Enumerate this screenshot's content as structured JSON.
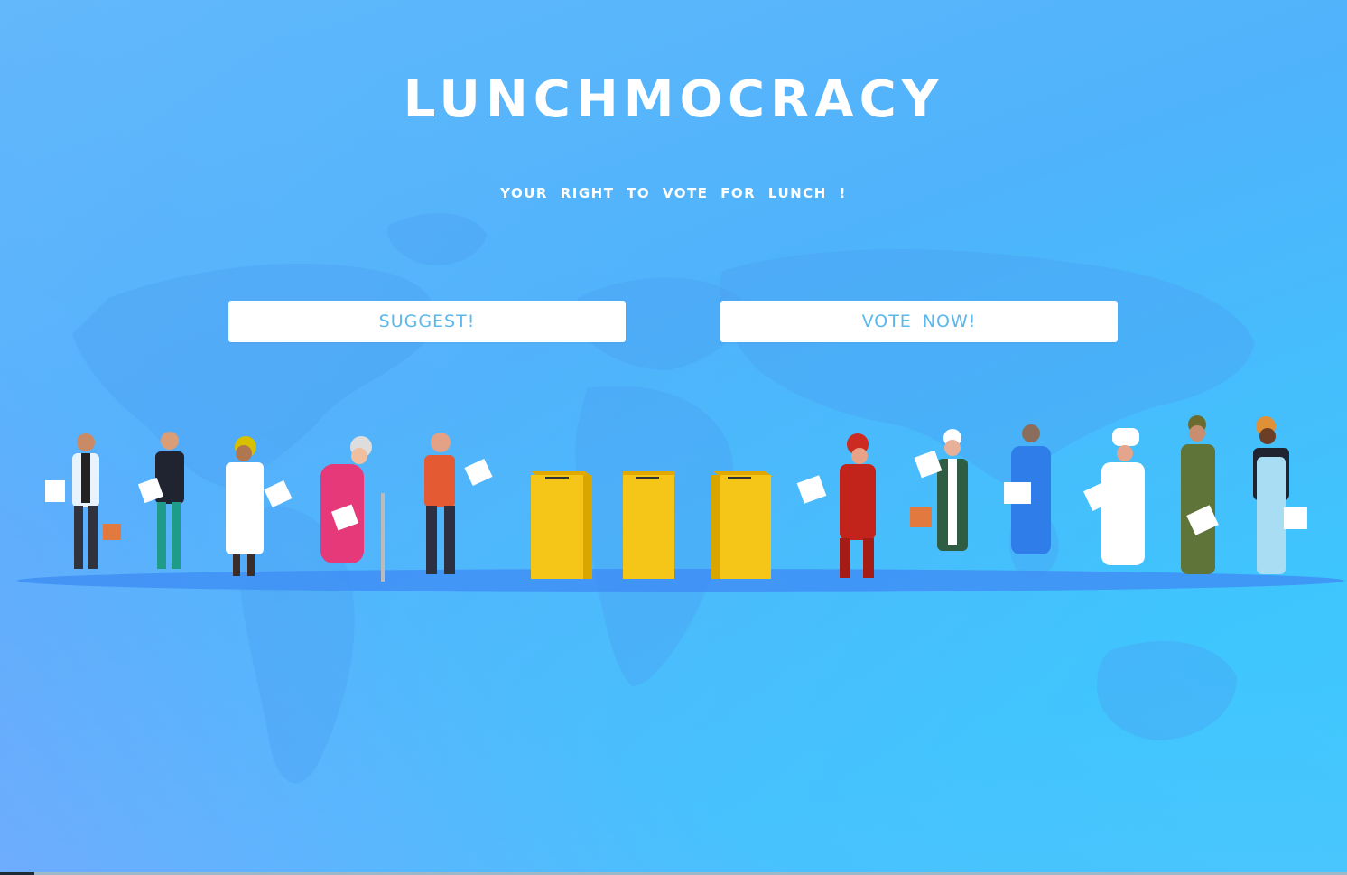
{
  "header": {
    "title": "LUNCHMOCRACY",
    "subtitle": "YOUR RIGHT TO VOTE FOR LUNCH !"
  },
  "actions": {
    "suggest_label": "SUGGEST!",
    "vote_label": "VOTE NOW!"
  },
  "illustration": {
    "ballot_box_count": 3,
    "voter_count": 11,
    "ballot_box_color": "#f5c518",
    "ground_color": "#3f8ff5"
  },
  "colors": {
    "background_top": "#5bb9fb",
    "background_right": "#3ec6fd",
    "button_text": "#5ab8ee",
    "title_text": "#ffffff"
  }
}
